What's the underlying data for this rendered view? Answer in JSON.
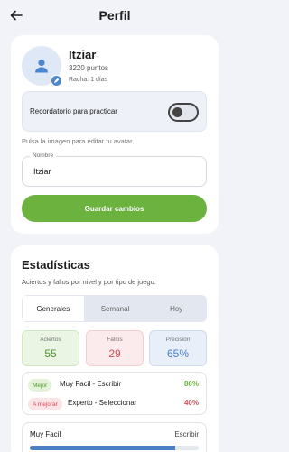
{
  "header": {
    "title": "Perfil"
  },
  "profile": {
    "name": "Itziar",
    "points": "3220 puntos",
    "streak": "Racha: 1 días",
    "reminder_label": "Recordatorio para practicar",
    "reminder_enabled": false,
    "avatar_hint": "Pulsa la imagen para editar tu avatar.",
    "name_field_label": "Nombre",
    "name_field_value": "Itziar",
    "save_label": "Guardar cambios"
  },
  "stats": {
    "title": "Estadísticas",
    "subtitle": "Aciertos y fallos por nivel y por tipo de juego.",
    "tabs": [
      {
        "label": "Generales",
        "active": true
      },
      {
        "label": "Semanal",
        "active": false
      },
      {
        "label": "Hoy",
        "active": false
      }
    ],
    "metrics": {
      "hits": {
        "label": "Aciertos",
        "value": "55"
      },
      "fails": {
        "label": "Fallos",
        "value": "29"
      },
      "precision": {
        "label": "Precisión",
        "value": "65%"
      }
    },
    "best": {
      "badge": "Mejor",
      "level": "Muy Facil - Escribir",
      "pct": "86%"
    },
    "worst": {
      "badge": "A mejorar",
      "level": "Experto - Seleccionar",
      "pct": "40%"
    },
    "level_bar": {
      "level": "Muy Facil",
      "type": "Escribir",
      "progress": 0.86
    }
  },
  "colors": {
    "accent_green": "#6bb33e",
    "accent_red": "#d94b55",
    "accent_blue": "#4a7fc4"
  },
  "icons": {
    "back": "arrow-left-icon",
    "avatar": "person-icon",
    "avatar_edit": "pencil-icon"
  }
}
